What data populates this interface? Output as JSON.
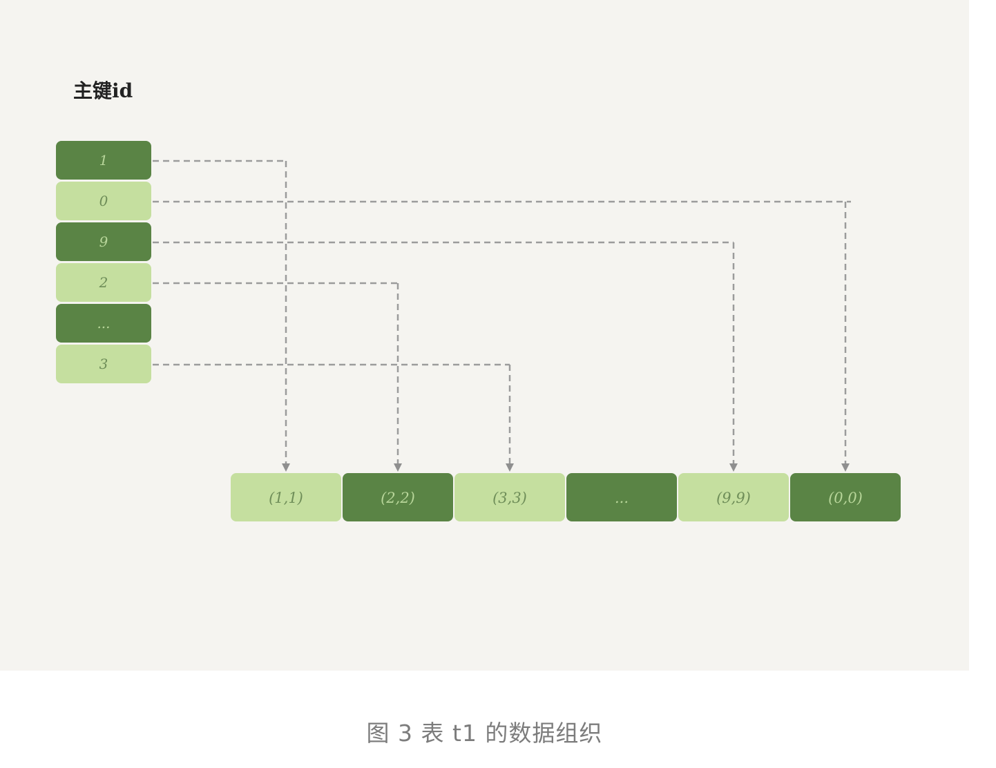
{
  "diagram": {
    "index_title": "主键id",
    "index_nodes": [
      {
        "label": "1",
        "tone": "dark"
      },
      {
        "label": "0",
        "tone": "light"
      },
      {
        "label": "9",
        "tone": "dark"
      },
      {
        "label": "2",
        "tone": "light"
      },
      {
        "label": "...",
        "tone": "dark"
      },
      {
        "label": "3",
        "tone": "light"
      }
    ],
    "data_nodes": [
      {
        "label": "(1,1)",
        "tone": "light"
      },
      {
        "label": "(2,2)",
        "tone": "dark"
      },
      {
        "label": "(3,3)",
        "tone": "light"
      },
      {
        "label": "...",
        "tone": "dark"
      },
      {
        "label": "(9,9)",
        "tone": "light"
      },
      {
        "label": "(0,0)",
        "tone": "dark"
      }
    ],
    "links": [
      {
        "from": 0,
        "to": 0
      },
      {
        "from": 1,
        "to": 5
      },
      {
        "from": 2,
        "to": 4
      },
      {
        "from": 3,
        "to": 1
      },
      {
        "from": 5,
        "to": 2
      }
    ],
    "colors": {
      "dark_fill": "#5a8445",
      "dark_text": "#b8d69a",
      "light_fill": "#c5df9f",
      "light_text": "#6e8d58",
      "connector": "#9b9b9b"
    }
  },
  "caption": "图 3 表 t1 的数据组织"
}
